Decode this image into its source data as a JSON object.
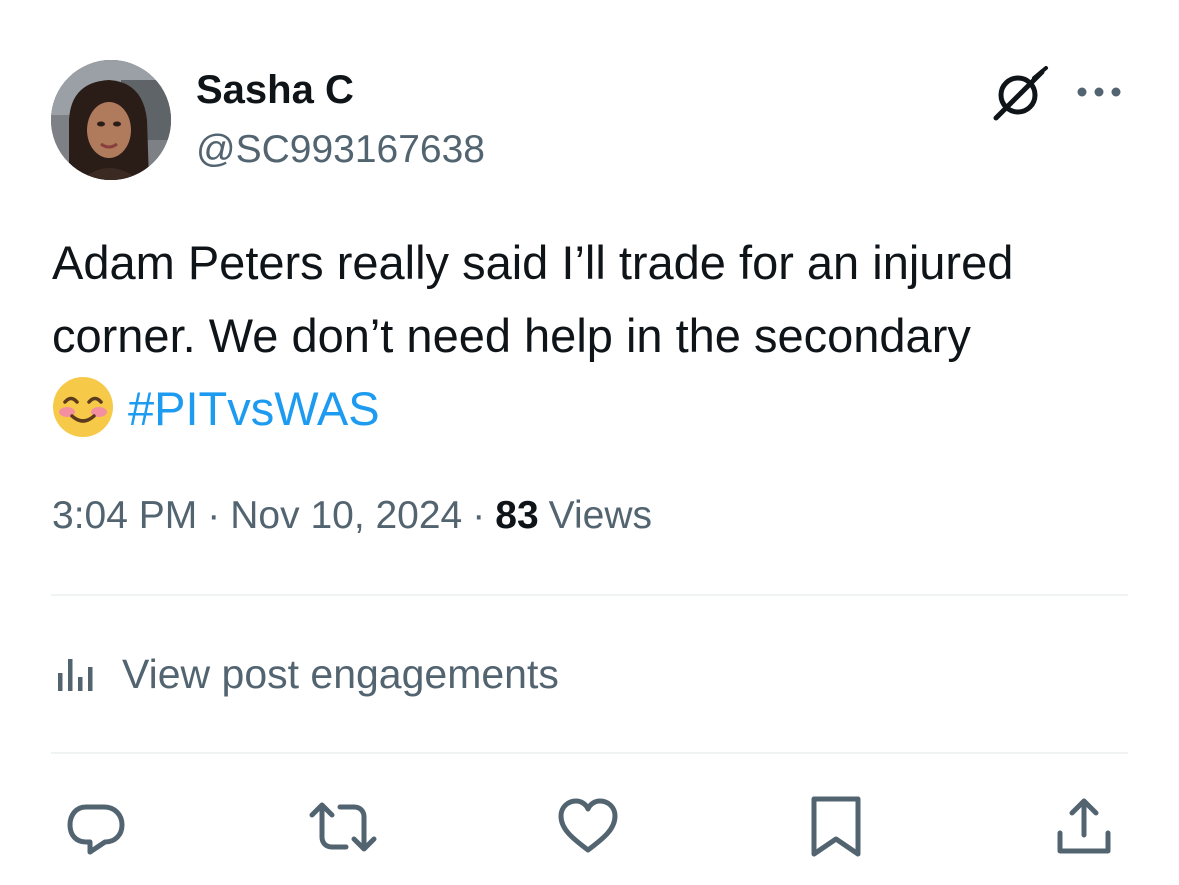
{
  "author": {
    "display_name": "Sasha C",
    "handle": "@SC993167638",
    "avatar_icon": "profile-photo"
  },
  "header_actions": {
    "grok_icon": "grok-icon",
    "more_icon": "more-horizontal-icon"
  },
  "tweet": {
    "line1": "Adam Peters really said I’ll trade for an injured",
    "line2": "corner. We don’t need help in the secondary",
    "emoji": "smiling-face-with-smiling-eyes",
    "hashtag": "#PITvsWAS"
  },
  "meta": {
    "time": "3:04 PM",
    "separator": "·",
    "date": "Nov 10, 2024",
    "views_count": "83",
    "views_label": "Views"
  },
  "engagements": {
    "label": "View post engagements",
    "icon": "analytics-bars-icon"
  },
  "actions": [
    {
      "name": "reply",
      "icon": "reply-icon"
    },
    {
      "name": "repost",
      "icon": "repost-icon"
    },
    {
      "name": "like",
      "icon": "heart-icon"
    },
    {
      "name": "bookmark",
      "icon": "bookmark-icon"
    },
    {
      "name": "share",
      "icon": "share-icon"
    }
  ],
  "colors": {
    "text": "#0f1419",
    "secondary": "#536471",
    "link": "#1d9bf0",
    "divider": "#eff3f4"
  }
}
